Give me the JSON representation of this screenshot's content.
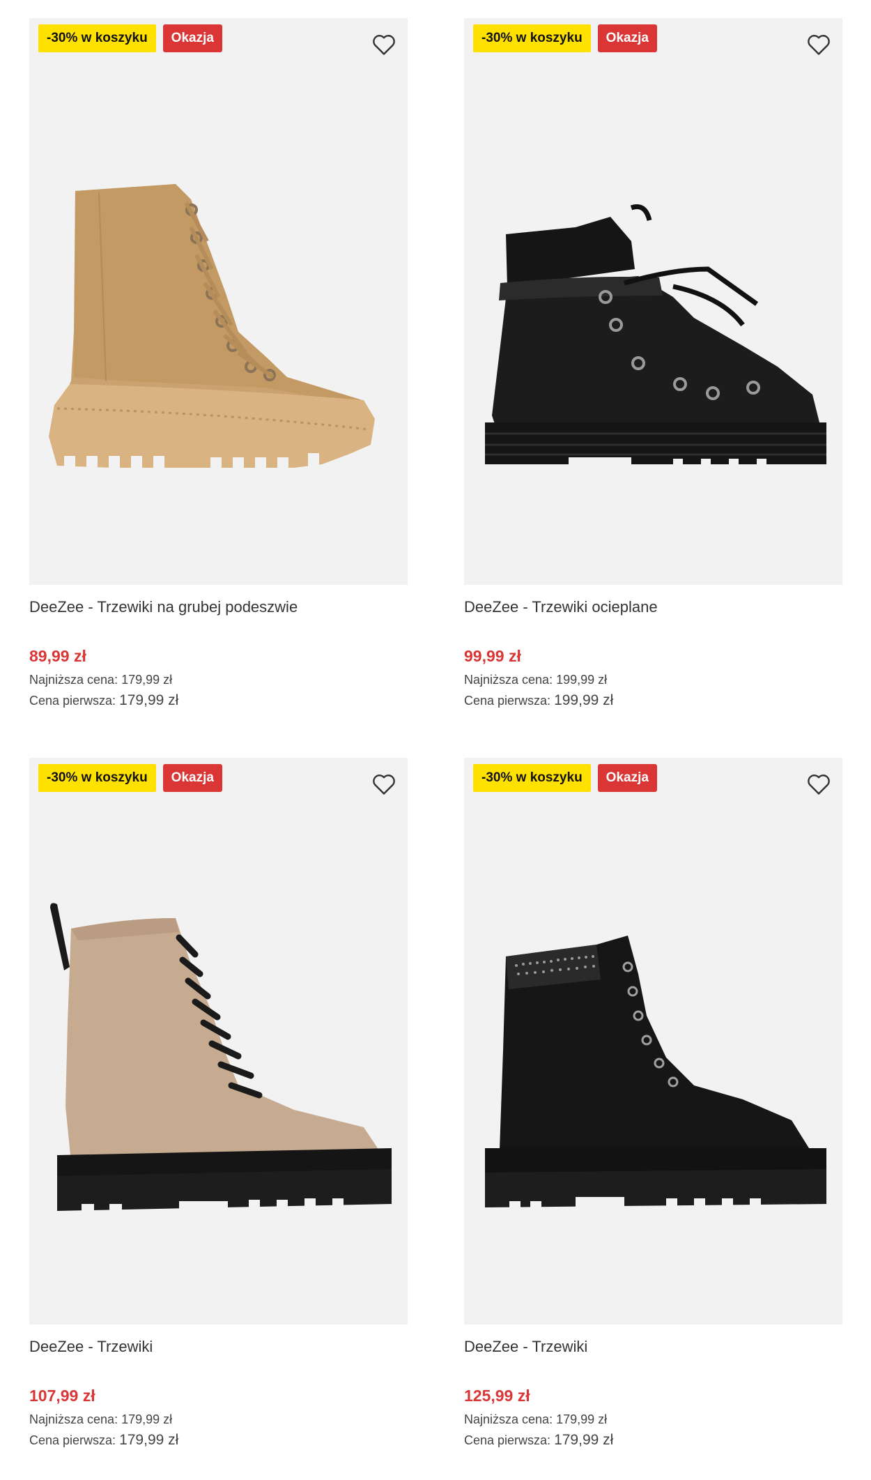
{
  "colors": {
    "promo_badge": "#ffe100",
    "deal_badge": "#d93635",
    "price": "#d93635",
    "image_bg": "#f2f2f2"
  },
  "products": [
    {
      "promo_badge": "-30% w koszyku",
      "deal_badge": "Okazja",
      "wishlist_icon": "heart-outline-icon",
      "image": "tan-suede-lace-up-platform-boot",
      "title": "DeeZee - Trzewiki na grubej podeszwie",
      "price": "89,99 zł",
      "lowest_label": "Najniższa cena:",
      "lowest_value": "179,99 zł",
      "first_label": "Cena pierwsza:",
      "first_value": "179,99 zł"
    },
    {
      "promo_badge": "-30% w koszyku",
      "deal_badge": "Okazja",
      "wishlist_icon": "heart-outline-icon",
      "image": "black-padded-hiking-boot",
      "title": "DeeZee - Trzewiki ocieplane",
      "price": "99,99 zł",
      "lowest_label": "Najniższa cena:",
      "lowest_value": "199,99 zł",
      "first_label": "Cena pierwsza:",
      "first_value": "199,99 zł"
    },
    {
      "promo_badge": "-30% w koszyku",
      "deal_badge": "Okazja",
      "wishlist_icon": "heart-outline-icon",
      "image": "beige-combat-boot-black-sole",
      "title": "DeeZee - Trzewiki",
      "price": "107,99 zł",
      "lowest_label": "Najniższa cena:",
      "lowest_value": "179,99 zł",
      "first_label": "Cena pierwsza:",
      "first_value": "179,99 zł"
    },
    {
      "promo_badge": "-30% w koszyku",
      "deal_badge": "Okazja",
      "wishlist_icon": "heart-outline-icon",
      "image": "black-suede-boot-rhinestone-collar",
      "title": "DeeZee - Trzewiki",
      "price": "125,99 zł",
      "lowest_label": "Najniższa cena:",
      "lowest_value": "179,99 zł",
      "first_label": "Cena pierwsza:",
      "first_value": "179,99 zł"
    }
  ]
}
